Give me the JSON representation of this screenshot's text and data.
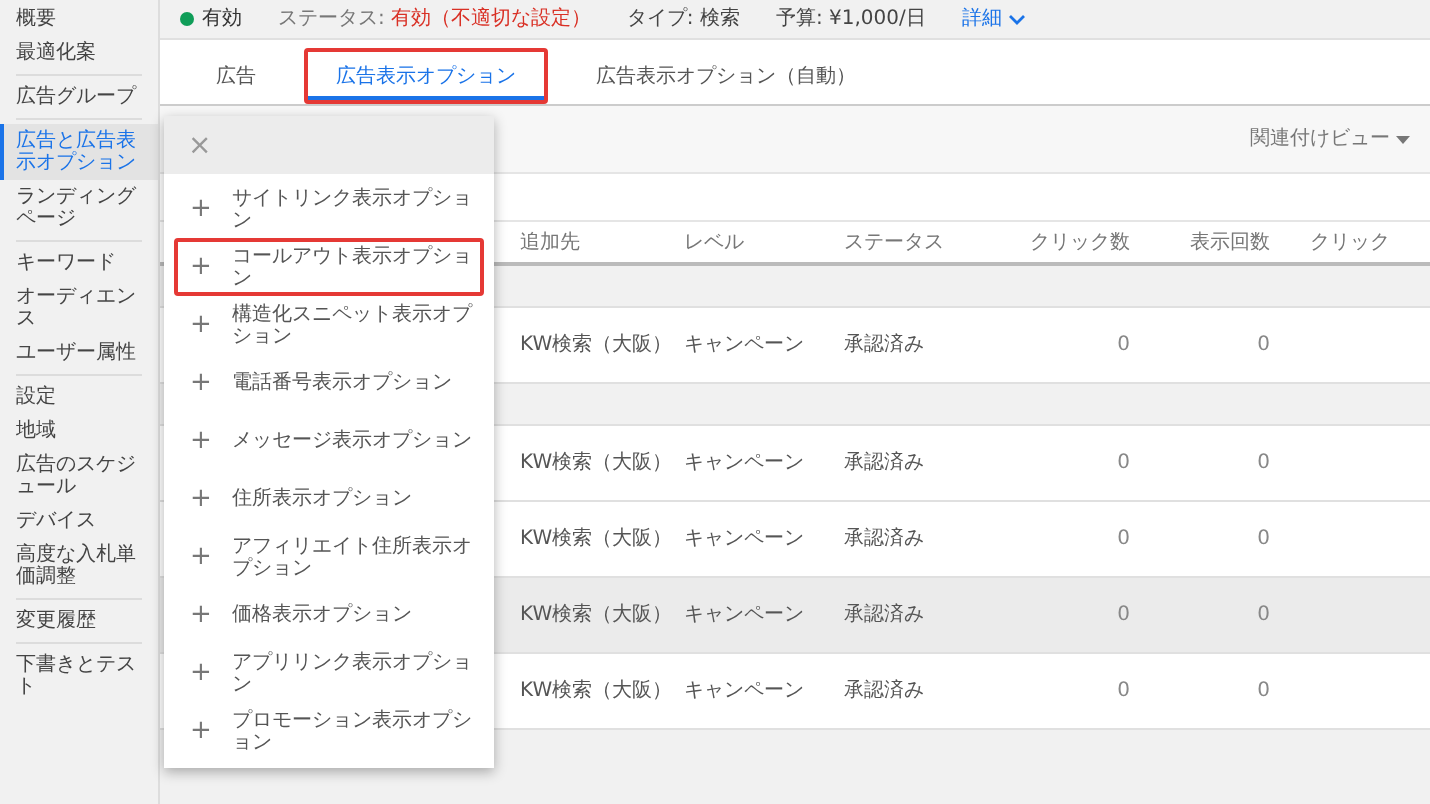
{
  "status_bar": {
    "state": {
      "label": "有効",
      "color": "#0f9d58"
    },
    "status_label": "ステータス:",
    "status_value": "有効（不適切な設定）",
    "type": "タイプ: 検索",
    "budget": "予算: ¥1,000/日",
    "details": "詳細"
  },
  "sidebar": {
    "groups": [
      [
        {
          "label": "概要",
          "selected": false
        },
        {
          "label": "最適化案",
          "selected": false
        }
      ],
      [
        {
          "label": "広告グループ",
          "selected": false
        }
      ],
      [
        {
          "label": "広告と広告表示オプション",
          "selected": true
        },
        {
          "label": "ランディングページ",
          "selected": false
        }
      ],
      [
        {
          "label": "キーワード",
          "selected": false
        },
        {
          "label": "オーディエンス",
          "selected": false
        },
        {
          "label": "ユーザー属性",
          "selected": false
        }
      ],
      [
        {
          "label": "設定",
          "selected": false
        },
        {
          "label": "地域",
          "selected": false
        },
        {
          "label": "広告のスケジュール",
          "selected": false
        },
        {
          "label": "デバイス",
          "selected": false
        },
        {
          "label": "高度な入札単価調整",
          "selected": false
        }
      ],
      [
        {
          "label": "変更履歴",
          "selected": false
        }
      ],
      [
        {
          "label": "下書きとテスト",
          "selected": false
        }
      ]
    ]
  },
  "tabs": [
    {
      "label": "広告",
      "selected": false,
      "highlighted": false
    },
    {
      "label": "広告表示オプション",
      "selected": true,
      "highlighted": true
    },
    {
      "label": "広告表示オプション（自動）",
      "selected": false,
      "highlighted": false
    }
  ],
  "toolbar": {
    "view_selector": "関連付けビュー"
  },
  "table": {
    "columns": [
      "追加先",
      "レベル",
      "ステータス",
      "クリック数",
      "表示回数",
      "クリック"
    ],
    "rows": [
      {
        "kind": "group"
      },
      {
        "kind": "data",
        "highlighted": false,
        "cells": [
          "KW検索（大阪）",
          "キャンペーン",
          "承認済み",
          "0",
          "0"
        ]
      },
      {
        "kind": "group"
      },
      {
        "kind": "data",
        "highlighted": false,
        "cells": [
          "KW検索（大阪）",
          "キャンペーン",
          "承認済み",
          "0",
          "0"
        ]
      },
      {
        "kind": "data",
        "highlighted": false,
        "cells": [
          "KW検索（大阪）",
          "キャンペーン",
          "承認済み",
          "0",
          "0"
        ]
      },
      {
        "kind": "data",
        "highlighted": true,
        "cells": [
          "KW検索（大阪）",
          "キャンペーン",
          "承認済み",
          "0",
          "0"
        ]
      },
      {
        "kind": "data",
        "highlighted": false,
        "cells": [
          "KW検索（大阪）",
          "キャンペーン",
          "承認済み",
          "0",
          "0"
        ]
      }
    ]
  },
  "menu": {
    "close": "×",
    "items": [
      {
        "icon": "+",
        "label": "サイトリンク表示オプション",
        "highlighted": false
      },
      {
        "icon": "+",
        "label": "コールアウト表示オプション",
        "highlighted": true
      },
      {
        "icon": "+",
        "label": "構造化スニペット表示オプション",
        "highlighted": false
      },
      {
        "icon": "+",
        "label": "電話番号表示オプション",
        "highlighted": false
      },
      {
        "icon": "+",
        "label": "メッセージ表示オプション",
        "highlighted": false
      },
      {
        "icon": "+",
        "label": "住所表示オプション",
        "highlighted": false
      },
      {
        "icon": "+",
        "label": "アフィリエイト住所表示オプション",
        "highlighted": false
      },
      {
        "icon": "+",
        "label": "価格表示オプション",
        "highlighted": false
      },
      {
        "icon": "+",
        "label": "アプリリンク表示オプション",
        "highlighted": false
      },
      {
        "icon": "+",
        "label": "プロモーション表示オプション",
        "highlighted": false
      }
    ]
  }
}
